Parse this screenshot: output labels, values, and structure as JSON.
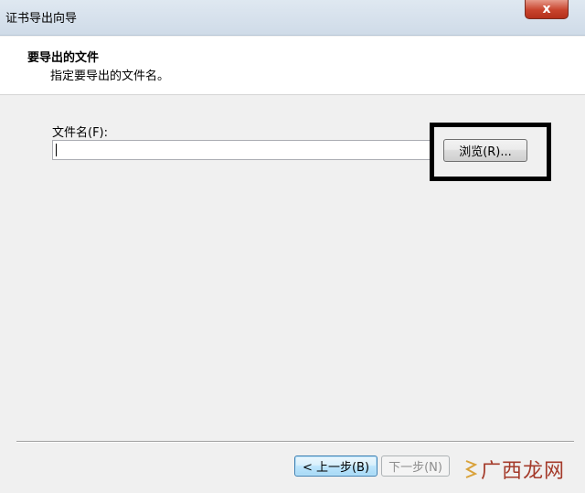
{
  "window": {
    "title": "证书导出向导",
    "close_symbol": "x"
  },
  "header": {
    "title": "要导出的文件",
    "subtitle": "指定要导出的文件名。"
  },
  "form": {
    "file_label": "文件名(F):",
    "file_value": ""
  },
  "buttons": {
    "browse": "浏览(R)...",
    "back": "< 上一步(B)",
    "next": "下一步(N)"
  },
  "watermark": {
    "text": "广西龙网"
  },
  "colors": {
    "accent": "#3c7fb1",
    "watermark": "#a43a2a",
    "highlight": "#000000"
  }
}
